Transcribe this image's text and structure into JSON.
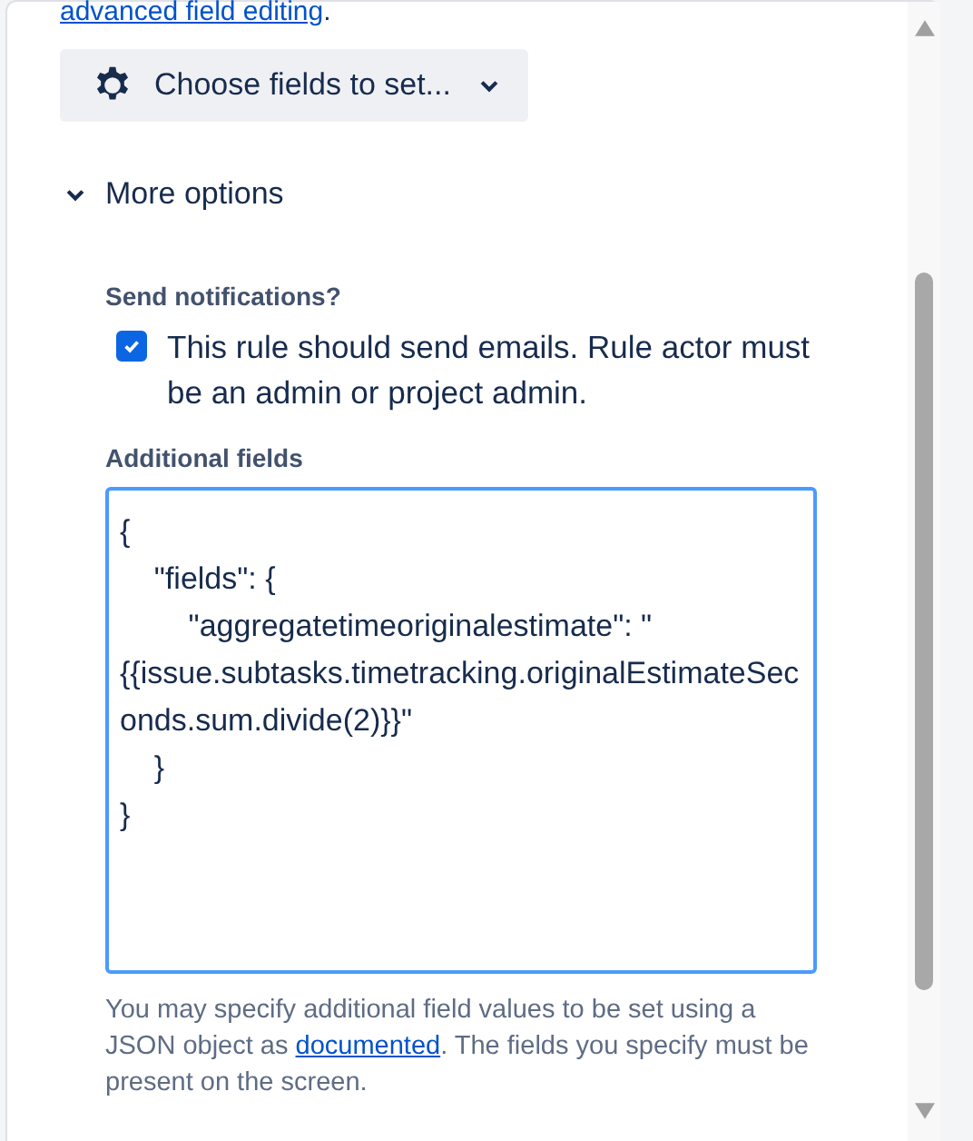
{
  "top_link": "advanced field editing",
  "top_link_after": ".",
  "choose_button": {
    "label": "Choose fields to set..."
  },
  "more_options": {
    "label": "More options",
    "expanded": true
  },
  "send_notifications": {
    "label": "Send notifications?",
    "checkbox_label": "This rule should send emails. Rule actor must be an admin or project admin.",
    "checked": true
  },
  "additional_fields": {
    "label": "Additional fields",
    "value": "{\n    \"fields\": {\n        \"aggregatetimeoriginalestimate\": \"{{issue.subtasks.timetracking.originalEstimateSeconds.sum.divide(2)}}\"\n    }\n}",
    "help_before": "You may specify additional field values to be set using a JSON object as ",
    "help_link": "documented",
    "help_after": ". The fields you specify must be present on the screen."
  }
}
